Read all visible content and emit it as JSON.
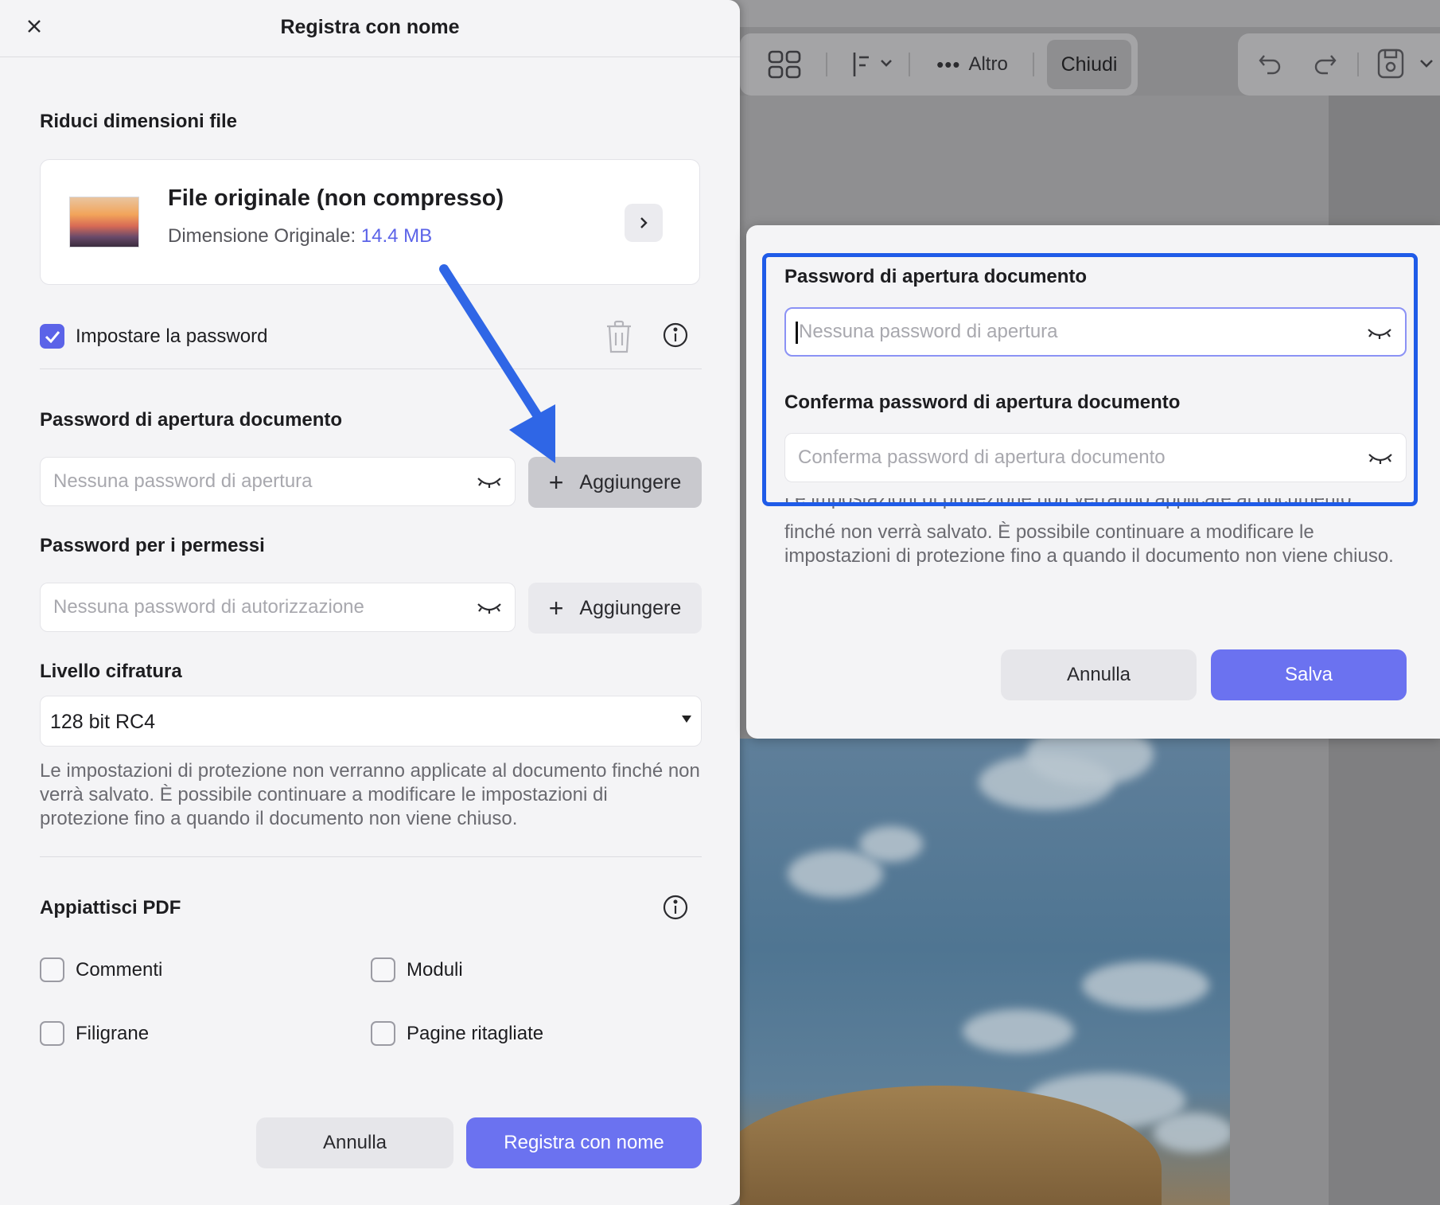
{
  "background": {
    "toolbar": {
      "more_label": "Altro",
      "close_label": "Chiudi"
    }
  },
  "dialog": {
    "title": "Registra con nome",
    "reduce_section": {
      "title": "Riduci dimensioni file",
      "file_name": "File originale (non compresso)",
      "size_label": "Dimensione Originale:",
      "size_value": "14.4 MB"
    },
    "set_password": {
      "label": "Impostare la password",
      "checked": true
    },
    "open_password": {
      "title": "Password di apertura documento",
      "placeholder": "Nessuna password di apertura",
      "add_label": "Aggiungere"
    },
    "permission_password": {
      "title": "Password per i permessi",
      "placeholder": "Nessuna password di autorizzazione",
      "add_label": "Aggiungere"
    },
    "encryption": {
      "title": "Livello cifratura",
      "selected": "128 bit RC4"
    },
    "note": "Le impostazioni di protezione non verranno applicate al documento finché non verrà salvato. È possibile continuare a modificare le impostazioni di protezione fino a quando il documento non viene chiuso.",
    "flatten": {
      "title": "Appiattisci PDF",
      "options": [
        {
          "label": "Commenti",
          "checked": false
        },
        {
          "label": "Moduli",
          "checked": false
        },
        {
          "label": "Filigrane",
          "checked": false
        },
        {
          "label": "Pagine ritagliate",
          "checked": false
        }
      ]
    },
    "cancel_label": "Annulla",
    "save_as_label": "Registra con nome"
  },
  "popup": {
    "open_label": "Password di apertura documento",
    "open_placeholder": "Nessuna password di apertura",
    "confirm_label": "Conferma password di apertura documento",
    "confirm_placeholder": "Conferma password di apertura documento",
    "note_cut": "Le impostazioni di protezione non verranno applicate al documento",
    "note_rest": "finché non verrà salvato. È possibile continuare a modificare le impostazioni di protezione fino a quando il documento non viene chiuso.",
    "cancel_label": "Annulla",
    "save_label": "Salva"
  },
  "colors": {
    "accent": "#6b72f0",
    "highlight": "#1f5be8",
    "checkbox_on": "#5b63e8"
  }
}
